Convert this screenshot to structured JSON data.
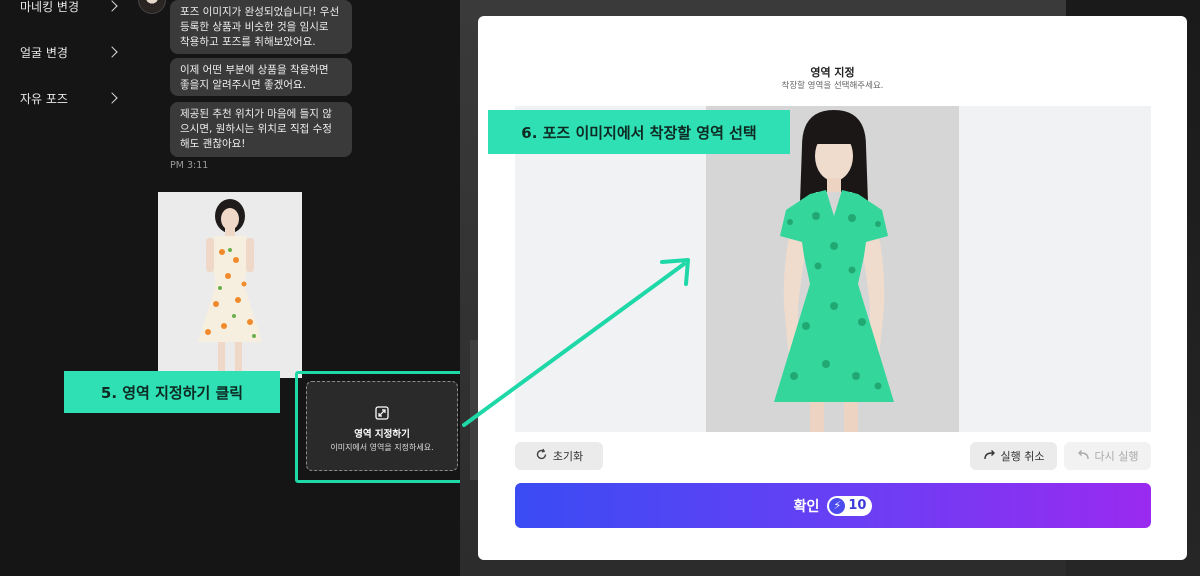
{
  "sidebar": {
    "items": [
      {
        "label": "마네킹 변경"
      },
      {
        "label": "얼굴 변경"
      },
      {
        "label": "자유 포즈"
      }
    ]
  },
  "chat": {
    "messages": [
      "포즈 이미지가 완성되었습니다! 우선\n등록한 상품과 비슷한 것을 임시로\n착용하고 포즈를 취해보았어요.",
      "이제 어떤 부분에 상품을 착용하면\n좋을지 알려주시면 좋겠어요.",
      "제공된 추천 위치가 마음에 들지 않\n으시면, 원하시는 위치로 직접 수정\n해도 괜찮아요!"
    ],
    "timestamp": "PM 3:11"
  },
  "area_button": {
    "title": "영역 지정하기",
    "subtitle": "이미지에서 영역을 지정하세요."
  },
  "callouts": {
    "step5": "5. 영역 지정하기 클릭",
    "step6": "6. 포즈 이미지에서 착장할 영역 선택"
  },
  "modal": {
    "title": "영역 지정",
    "subtitle": "착장할 영역을 선택해주세요.",
    "reset_label": "초기화",
    "undo_label": "실행 취소",
    "redo_label": "다시 실행",
    "confirm_label": "확인",
    "credit_cost": "10"
  },
  "colors": {
    "accent_green": "#2ee0b4",
    "confirm_gradient_start": "#3a4cf4",
    "confirm_gradient_end": "#9a2af0",
    "dress_green": "#35d69b"
  }
}
